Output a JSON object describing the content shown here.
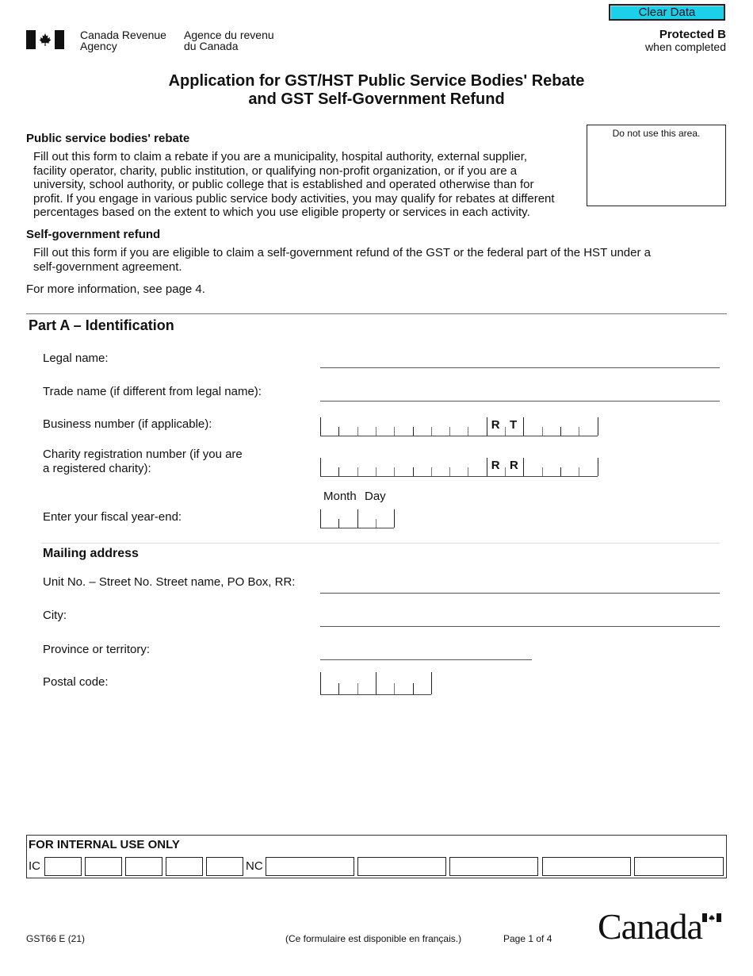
{
  "header": {
    "agency_en_line1": "Canada Revenue",
    "agency_en_line2": "Agency",
    "agency_fr_line1": "Agence du revenu",
    "agency_fr_line2": "du Canada",
    "clear_button": "Clear Data",
    "protected_label": "Protected B",
    "protected_sub": "when completed",
    "flag_icon": "canada-flag-icon"
  },
  "title": {
    "line1": "Application for GST/HST Public Service Bodies' Rebate",
    "line2": "and GST Self-Government Refund"
  },
  "intro": {
    "psb_heading": "Public service bodies' rebate",
    "psb_lines": [
      "Fill out this form to claim a rebate if you are a municipality, hospital authority, external supplier,",
      "facility operator, charity, public institution, or qualifying non-profit organization, or if you are a",
      "university, school authority, or public college that is established and operated otherwise than for",
      "profit. If you engage in various public service body activities, you may qualify for rebates at different",
      "percentages based on the extent to which you use eligible property or services in each activity."
    ],
    "do_not_use": "Do not use this area.",
    "sg_heading": "Self-government refund",
    "sg_lines": [
      "Fill out this form if you are eligible to claim a self-government refund of the GST or the federal part of the HST under a",
      "self-government agreement."
    ],
    "more_info": "For more information, see page 4."
  },
  "partA": {
    "title": "Part A – Identification",
    "legal_name_label": "Legal name:",
    "legal_name_value": "",
    "trade_name_label": "Trade name (if different from legal name):",
    "trade_name_value": "",
    "bn_label": "Business number (if applicable):",
    "bn_program": [
      "R",
      "T"
    ],
    "charity_label_line1": "Charity registration number (if you are",
    "charity_label_line2": "a registered charity):",
    "charity_program": [
      "R",
      "R"
    ],
    "month_label": "Month",
    "day_label": "Day",
    "fiscal_label": "Enter your fiscal year-end:",
    "mailing_heading": "Mailing address",
    "street_label": "Unit No. – Street No. Street name, PO Box, RR:",
    "city_label": "City:",
    "province_label": "Province or territory:",
    "postal_label": "Postal code:"
  },
  "internal": {
    "title": "FOR INTERNAL USE ONLY",
    "ic_label": "IC",
    "nc_label": "NC"
  },
  "footer": {
    "form_id": "GST66 E (21)",
    "french_note": "(Ce formulaire est disponible en français.)",
    "page": "Page 1 of 4",
    "wordmark": "Canada"
  }
}
